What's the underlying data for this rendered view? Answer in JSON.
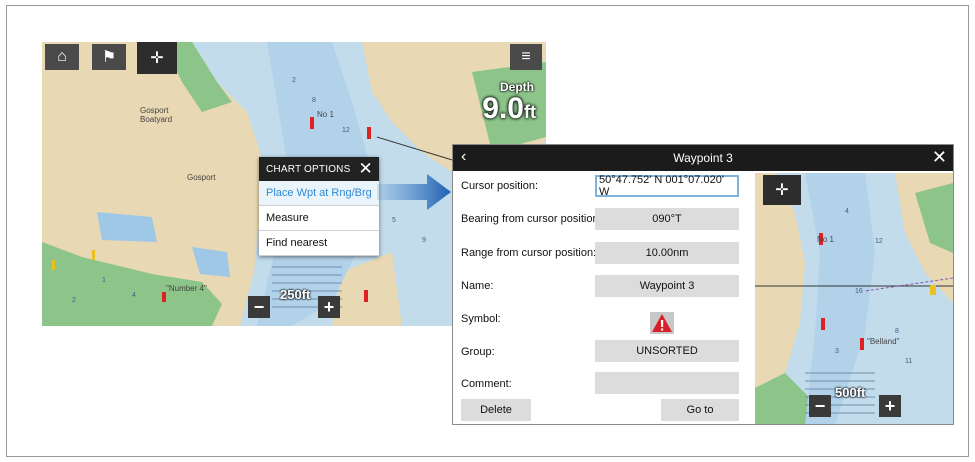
{
  "left_chart": {
    "toolbar": {
      "home_icon": "home-icon",
      "waypoint_icon": "waypoint-list-icon",
      "boat_icon": "vessel-position-icon",
      "menu_icon": "menu-icon"
    },
    "depth": {
      "label": "Depth",
      "value": "9.0",
      "unit": "ft"
    },
    "scale": "250ft",
    "zoom_out": "−",
    "zoom_in": "+",
    "place_labels": {
      "gosport": "Gosport",
      "gosport_boatyard": "Gosport\nBoatyard",
      "no1": "No 1",
      "number4": "\"Number 4\""
    }
  },
  "chart_options": {
    "title": "CHART OPTIONS",
    "close": "✕",
    "items": [
      "Place Wpt at Rng/Brg",
      "Measure",
      "Find nearest"
    ]
  },
  "waypoint_dialog": {
    "title": "Waypoint 3",
    "back": "‹",
    "close": "✕",
    "rows": [
      {
        "label": "Cursor position:",
        "value": "50°47.752' N  001°07.020' W"
      },
      {
        "label": "Bearing from cursor position:",
        "value": "090°T"
      },
      {
        "label": "Range from cursor position:",
        "value": "10.00nm"
      },
      {
        "label": "Name:",
        "value": "Waypoint 3"
      },
      {
        "label": "Symbol:",
        "value": ""
      },
      {
        "label": "Group:",
        "value": "UNSORTED"
      },
      {
        "label": "Comment:",
        "value": ""
      }
    ],
    "delete_button": "Delete",
    "goto_button": "Go to",
    "mini_chart": {
      "scale": "500ft",
      "zoom_out": "−",
      "zoom_in": "+",
      "label_no1": "No 1",
      "label_belland": "\"Belland\""
    }
  }
}
